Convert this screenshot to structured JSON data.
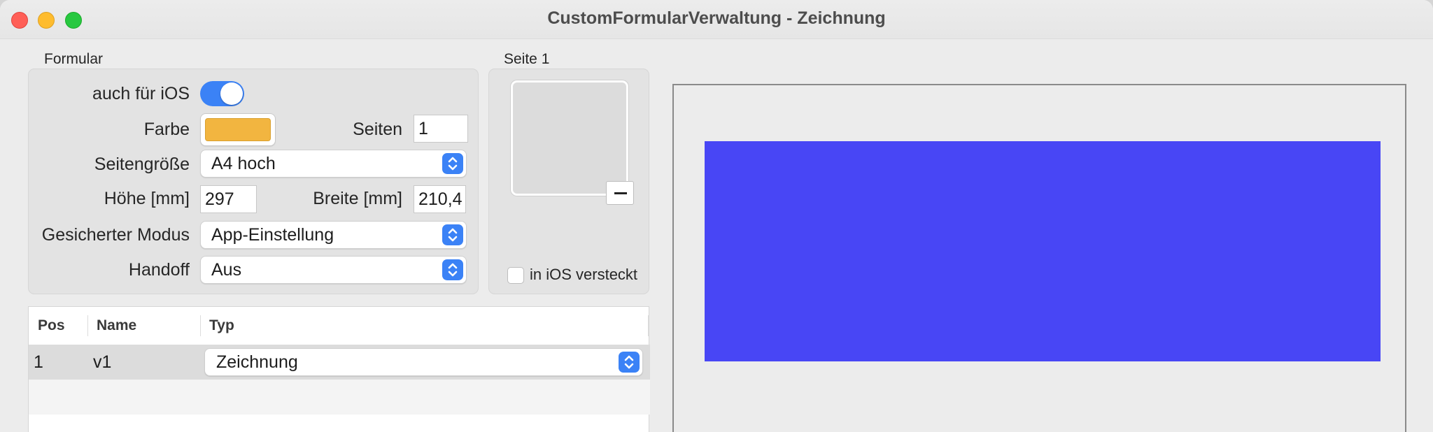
{
  "window": {
    "title": "CustomFormularVerwaltung - Zeichnung"
  },
  "formular": {
    "group_label": "Formular",
    "ios_label": "auch für iOS",
    "ios_enabled": true,
    "farbe_label": "Farbe",
    "farbe_color": "#f2b540",
    "seiten_label": "Seiten",
    "seiten_value": "1",
    "seitengroesse_label": "Seitengröße",
    "seitengroesse_value": "A4 hoch",
    "hoehe_label": "Höhe [mm]",
    "hoehe_value": "297",
    "breite_label": "Breite [mm]",
    "breite_value": "210,4",
    "modus_label": "Gesicherter Modus",
    "modus_value": "App-Einstellung",
    "handoff_label": "Handoff",
    "handoff_value": "Aus"
  },
  "seite": {
    "group_label": "Seite 1",
    "remove_icon": "minus-icon",
    "ios_hidden_label": "in iOS versteckt",
    "ios_hidden_checked": false
  },
  "table": {
    "columns": [
      "Pos",
      "Name",
      "Typ"
    ],
    "rows": [
      {
        "pos": "1",
        "name": "v1",
        "typ": "Zeichnung"
      }
    ]
  },
  "drawing": {
    "fill_color": "#4846f5"
  }
}
